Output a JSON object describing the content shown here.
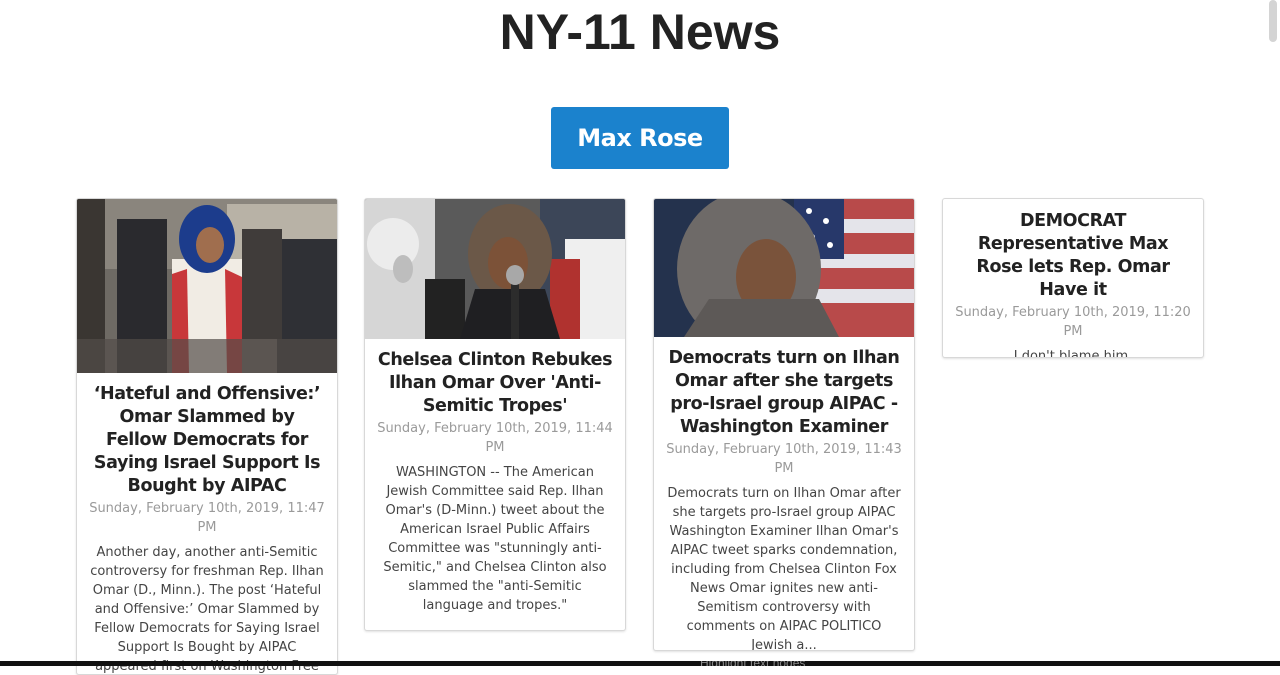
{
  "page": {
    "title": "NY-11 News"
  },
  "filter": {
    "label": "Max Rose"
  },
  "articles": [
    {
      "title": "‘Hateful and Offensive:’ Omar Slammed by Fellow Democrats for Saying Israel Support Is Bought by AIPAC",
      "date": "Sunday, February 10th, 2019, 11:47 PM",
      "description": "Another day, another anti-Semitic controversy for freshman Rep. Ilhan Omar (D., Minn.). The post ‘Hateful and Offensive:’ Omar Slammed by Fellow Democrats for Saying Israel Support Is Bought by AIPAC appeared first on Washington Free Beacon."
    },
    {
      "title": "Chelsea Clinton Rebukes Ilhan Omar Over 'Anti-Semitic Tropes'",
      "date": "Sunday, February 10th, 2019, 11:44 PM",
      "description": "WASHINGTON -- The American Jewish Committee said Rep. Ilhan Omar's (D-Minn.) tweet about the American Israel Public Affairs Committee was \"stunningly anti-Semitic,\" and Chelsea Clinton also slammed the \"anti-Semitic language and tropes.\""
    },
    {
      "title": "Democrats turn on Ilhan Omar after she targets pro-Israel group AIPAC - Washington Examiner",
      "date": "Sunday, February 10th, 2019, 11:43 PM",
      "description": "Democrats turn on Ilhan Omar after she targets pro-Israel group AIPAC Washington Examiner Ilhan Omar's AIPAC tweet sparks condemnation, including from Chelsea Clinton Fox News Omar ignites new anti-Semitism controversy with comments on AIPAC POLITICO Jewish a..."
    },
    {
      "title": "DEMOCRAT Representative Max Rose lets Rep. Omar Have it",
      "date": "Sunday, February 10th, 2019, 11:20 PM",
      "description": "I don't blame him."
    }
  ],
  "taskbar": {
    "ghost_text": "Highlight text nodes"
  }
}
